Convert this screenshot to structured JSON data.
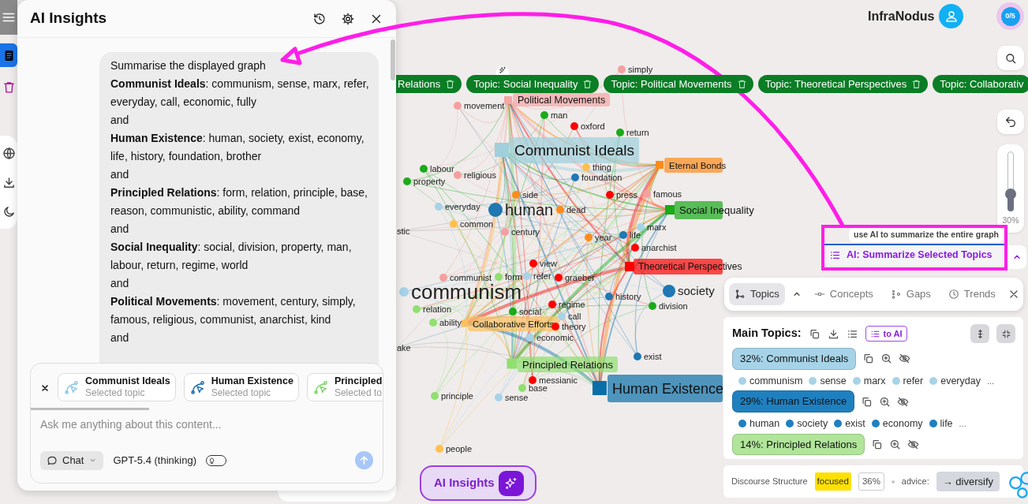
{
  "header": {
    "brand": "InfraNodus",
    "credits": "0/5"
  },
  "rail": [
    {
      "kind": "document",
      "selected": true
    },
    {
      "kind": "trash",
      "selected": false
    },
    {
      "kind": "globe",
      "selected": false
    },
    {
      "kind": "download",
      "selected": false
    },
    {
      "kind": "moon",
      "selected": false
    }
  ],
  "ai_panel": {
    "title": "AI Insights",
    "message_lines": [
      "Summarise the displayed graph",
      "**Communist Ideals**: communism, sense, marx, refer, everyday, call, economic, fully",
      "and",
      "**Human Existence**: human, society, exist, economy, life, history, foundation, brother",
      "and",
      "**Principled Relations**: form, relation, principle, base, reason, communistic, ability, command",
      "and",
      "**Social Inequality**: social, division, property, man, labour, return, regime, world",
      "and",
      "**Political Movements**: movement, century, simply, famous, religious, communist, anarchist, kind",
      "and"
    ],
    "chips": [
      {
        "title": "Communist Ideals",
        "subtitle": "Selected topic",
        "color": "#8ec9e6"
      },
      {
        "title": "Human Existence",
        "subtitle": "Selected topic",
        "color": "#1f6fb4"
      },
      {
        "title": "Principled",
        "subtitle": "Selected to",
        "color": "#7fd66a"
      }
    ],
    "placeholder": "Ask me anything about this content...",
    "mode": "Chat",
    "model": "GPT-5.4 (thinking)",
    "thinking": {
      "on": false
    }
  },
  "topic_filters": [
    "Relations",
    "Topic: Social Inequality",
    "Topic: Political Movements",
    "Topic: Theoretical Perspectives",
    "Topic: Collaborativ"
  ],
  "graph": {
    "topics": [
      {
        "label": "Political Movements",
        "color": "#f6a5a5"
      },
      {
        "label": "Communist Ideals",
        "color": "#9fd0dc"
      },
      {
        "label": "Eternal Bonds",
        "color": "#ff8c1a"
      },
      {
        "label": "Social Inequality",
        "color": "#1aaa1a"
      },
      {
        "label": "Theoretical Perspectives",
        "color": "#ff0000"
      },
      {
        "label": "Collaborative Efforts",
        "color": "#ffc060"
      },
      {
        "label": "Principled Relations",
        "color": "#90e070"
      },
      {
        "label": "Human Existence",
        "color": "#0a6fa8"
      }
    ],
    "nodes": [
      {
        "label": "simply",
        "kind": "word",
        "color": "#f4a0a0"
      },
      {
        "label": "movement",
        "kind": "word",
        "color": "#f4a0a0"
      },
      {
        "label": "man",
        "kind": "word",
        "color": "#1aaa1a"
      },
      {
        "label": "oxford",
        "kind": "word",
        "color": "#ff0000"
      },
      {
        "label": "return",
        "kind": "word",
        "color": "#1aaa1a"
      },
      {
        "label": "thing",
        "kind": "word",
        "color": "#ffc04d"
      },
      {
        "label": "foundation",
        "kind": "word",
        "color": "#1f77b4"
      },
      {
        "label": "labour",
        "kind": "word",
        "color": "#1aaa1a"
      },
      {
        "label": "property",
        "kind": "word",
        "color": "#1aaa1a"
      },
      {
        "label": "religious",
        "kind": "word",
        "color": "#f4a0a0"
      },
      {
        "label": "side",
        "kind": "word",
        "color": "#ff8c1a"
      },
      {
        "label": "press",
        "kind": "word",
        "color": "#ff0000"
      },
      {
        "label": "famous",
        "kind": "word",
        "color": "#f4a0a0"
      },
      {
        "label": "everyday",
        "kind": "word",
        "color": "#a6d3e8"
      },
      {
        "label": "human",
        "kind": "major",
        "color": "#1f77b4"
      },
      {
        "label": "common",
        "kind": "word",
        "color": "#ffc04d"
      },
      {
        "label": "dead",
        "kind": "word",
        "color": "#ff8c1a"
      },
      {
        "label": "century",
        "kind": "word",
        "color": "#f4a0a0"
      },
      {
        "label": "marx",
        "kind": "word",
        "color": "#a6d3e8"
      },
      {
        "label": "stic",
        "kind": "cut"
      },
      {
        "label": "year",
        "kind": "word",
        "color": "#ff8c1a"
      },
      {
        "label": "life",
        "kind": "word",
        "color": "#1f77b4"
      },
      {
        "label": "anarchist",
        "kind": "word",
        "color": "#ff0000"
      },
      {
        "label": "view",
        "kind": "word",
        "color": "#ff0000"
      },
      {
        "label": "communist",
        "kind": "word",
        "color": "#f4a0a0"
      },
      {
        "label": "form",
        "kind": "word",
        "color": "#90e070"
      },
      {
        "label": "refer",
        "kind": "word",
        "color": "#a6d3e8"
      },
      {
        "label": "graeber",
        "kind": "word",
        "color": "#ff0000"
      },
      {
        "label": "communism",
        "kind": "hub",
        "color": "#a6d3e8"
      },
      {
        "label": "relation",
        "kind": "word",
        "color": "#90e070"
      },
      {
        "label": "social",
        "kind": "word",
        "color": "#1aaa1a"
      },
      {
        "label": "regime",
        "kind": "word",
        "color": "#ff0000"
      },
      {
        "label": "history",
        "kind": "word",
        "color": "#1f77b4"
      },
      {
        "label": "society",
        "kind": "medium",
        "color": "#1f77b4"
      },
      {
        "label": "division",
        "kind": "word",
        "color": "#1aaa1a"
      },
      {
        "label": "ability",
        "kind": "word",
        "color": "#90e070"
      },
      {
        "label": "call",
        "kind": "word",
        "color": "#a6d3e8"
      },
      {
        "label": "theory",
        "kind": "word",
        "color": "#ff0000"
      },
      {
        "label": "economic",
        "kind": "word",
        "color": "#a6d3e8"
      },
      {
        "label": "ake",
        "kind": "cut"
      },
      {
        "label": "exist",
        "kind": "word",
        "color": "#1f77b4"
      },
      {
        "label": "messianic",
        "kind": "word",
        "color": "#ff0000"
      },
      {
        "label": "principle",
        "kind": "word",
        "color": "#90e070"
      },
      {
        "label": "sense",
        "kind": "word",
        "color": "#a6d3e8"
      },
      {
        "label": "base",
        "kind": "word",
        "color": "#90e070"
      },
      {
        "label": "people",
        "kind": "word",
        "color": "#ffc04d"
      }
    ]
  },
  "zoom": {
    "level": 0.3,
    "reading": "30%"
  },
  "summarize": {
    "hint": "use AI to summarize the entire graph",
    "button": "AI: Summarize Selected Topics"
  },
  "analysis_tabs": [
    {
      "label": "Topics",
      "kind": "topics",
      "selected": true
    },
    {
      "label": "Concepts",
      "kind": "concepts",
      "selected": false
    },
    {
      "label": "Gaps",
      "kind": "gaps",
      "selected": false
    },
    {
      "label": "Trends",
      "kind": "trends",
      "selected": false
    }
  ],
  "main_topics": {
    "title": "Main Topics:",
    "to_ai": "to AI",
    "topics": [
      {
        "label": "32%: Communist Ideals",
        "color": "#a6d3e8",
        "words": [
          "communism",
          "sense",
          "marx",
          "refer",
          "everyday"
        ],
        "more": "..."
      },
      {
        "label": "29%: Human Existence",
        "color": "#1f80c0",
        "words": [
          "human",
          "society",
          "exist",
          "economy",
          "life"
        ],
        "more": "..."
      },
      {
        "label": "14%: Principled Relations",
        "color": "#b0e59a"
      }
    ]
  },
  "discourse": {
    "label": "Discourse Structure",
    "state": "focused",
    "percent": "36%",
    "advice_label": "advice:",
    "advice": "→ diversify"
  },
  "ai_insights_button": "AI Insights"
}
